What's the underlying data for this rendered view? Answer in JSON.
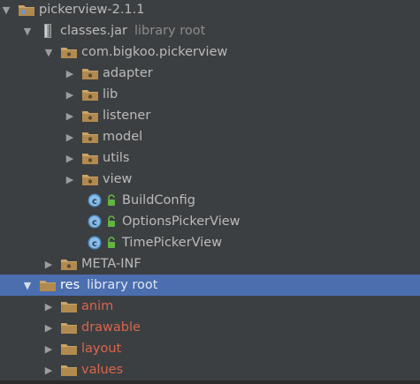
{
  "tree": {
    "root": {
      "label": "pickerview-2.1.1"
    },
    "classes_jar": {
      "label": "classes.jar",
      "hint": "library root"
    },
    "package": {
      "label": "com.bigkoo.pickerview"
    },
    "folders": [
      {
        "label": "adapter"
      },
      {
        "label": "lib"
      },
      {
        "label": "listener"
      },
      {
        "label": "model"
      },
      {
        "label": "utils"
      },
      {
        "label": "view"
      }
    ],
    "classes": [
      {
        "label": "BuildConfig"
      },
      {
        "label": "OptionsPickerView"
      },
      {
        "label": "TimePickerView"
      }
    ],
    "meta_inf": {
      "label": "META-INF"
    },
    "res": {
      "label": "res",
      "hint": "library root"
    },
    "res_folders": [
      {
        "label": "anim"
      },
      {
        "label": "drawable"
      },
      {
        "label": "layout"
      },
      {
        "label": "values"
      }
    ]
  },
  "icons": {
    "expanded": "triangle-down",
    "collapsed": "triangle-right",
    "folder": "folder-icon",
    "jar": "jar-icon",
    "package": "package-icon",
    "class": "class-icon",
    "lock": "lock-icon"
  },
  "colors": {
    "background": "#3c3f41",
    "selection": "#4b6eaf",
    "text": "#bbbbbb",
    "resource_text": "#d9664c",
    "hint_text": "#8c8c8c"
  }
}
